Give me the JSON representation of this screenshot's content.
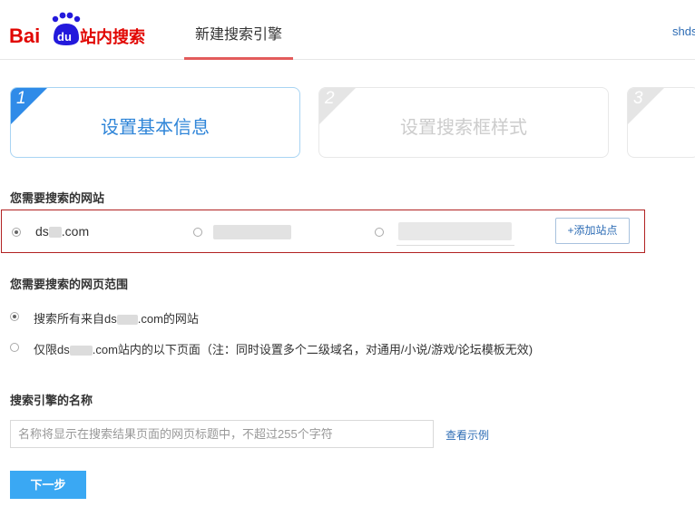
{
  "header": {
    "logo_text": "Bai du 站内搜索",
    "tab_label": "新建搜索引擎",
    "user_link": "shds"
  },
  "steps": [
    {
      "number": "1",
      "title": "设置基本信息"
    },
    {
      "number": "2",
      "title": "设置搜索框样式"
    },
    {
      "number": "3",
      "title": ""
    }
  ],
  "site_section": {
    "label": "您需要搜索的网站",
    "site1_prefix": "ds",
    "site1_suffix": ".com",
    "add_site_label": "+添加站点"
  },
  "scope_section": {
    "label": "您需要搜索的网页范围",
    "option1_prefix": "搜索所有来自ds",
    "option1_suffix": ".com的网站",
    "option2_prefix": "仅限ds",
    "option2_suffix": ".com站内的以下页面（注：同时设置多个二级域名，对通用/小说/游戏/论坛模板无效)"
  },
  "name_section": {
    "label": "搜索引擎的名称",
    "placeholder": "名称将显示在搜索结果页面的网页标题中，不超过255个字符",
    "view_example": "查看示例"
  },
  "next_button": "下一步",
  "colors": {
    "accent_blue": "#2f85d8",
    "button_blue": "#3aa8f3",
    "tab_underline": "#e35b5b",
    "highlight_border": "#b22222"
  }
}
